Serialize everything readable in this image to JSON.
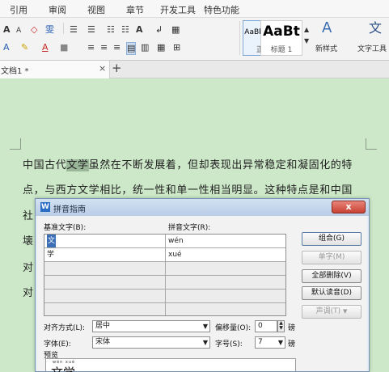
{
  "ribbon": {
    "menu": [
      "引用",
      "审阅",
      "视图",
      "章节",
      "开发工具",
      "特色功能"
    ],
    "row1": [
      "A",
      "A",
      "◇",
      "雯",
      "☰",
      "☰",
      "☷",
      "☷",
      "A",
      "↲",
      "▦"
    ],
    "row2": [
      "A",
      "✎",
      "A",
      "■",
      "≡",
      "≡",
      "≡",
      "▤",
      "▥",
      "▦",
      "⊞"
    ],
    "styles": [
      {
        "sample": "AaBbCcDd",
        "name": "正文"
      },
      {
        "sample": "AaBt",
        "name": "标题 1"
      }
    ],
    "new_style_label": "新样式",
    "text_tool_label": "文字工具",
    "text_tool_glyph": "文"
  },
  "tabs": {
    "doc_title": "文档1 *",
    "close": "×",
    "new": "+"
  },
  "document": {
    "line1": {
      "before": "中国古代",
      "highlight": "文学",
      "after": "虽然在不断发展着，但却表现出异常稳定和凝固化的特"
    },
    "line2": "点，与西方文学相比，统一性和单一性相当明显。这种特点是和中国",
    "stubs": [
      "社",
      "壊",
      "对",
      "对"
    ]
  },
  "dialog": {
    "title": "拼音指南",
    "close_glyph": "x",
    "base_text_label": "基准文字(B):",
    "ruby_text_label": "拼音文字(R):",
    "rows": [
      {
        "base": "文",
        "ruby": "wén"
      },
      {
        "base": "学",
        "ruby": "xué"
      }
    ],
    "buttons": {
      "group": "组合(G)",
      "single": "单字(M)",
      "clear_all": "全部删除(V)",
      "default_reading": "默认读音(D)",
      "tone": "声调(T)"
    },
    "alignment_label": "对齐方式(L):",
    "alignment_value": "居中",
    "offset_label": "偏移量(O):",
    "offset_value": "0",
    "offset_unit": "磅",
    "font_label": "字体(E):",
    "font_value": "宋体",
    "size_label": "字号(S):",
    "size_value": "7",
    "size_unit": "磅",
    "preview_label": "预览",
    "preview_ruby": "wén xué",
    "preview_text": "文学"
  },
  "colors": {
    "doc_background": "#cce8c8",
    "dialog_titlebar": "#b9cde6",
    "close_button": "#c74234",
    "selection": "#3d6fb6"
  }
}
